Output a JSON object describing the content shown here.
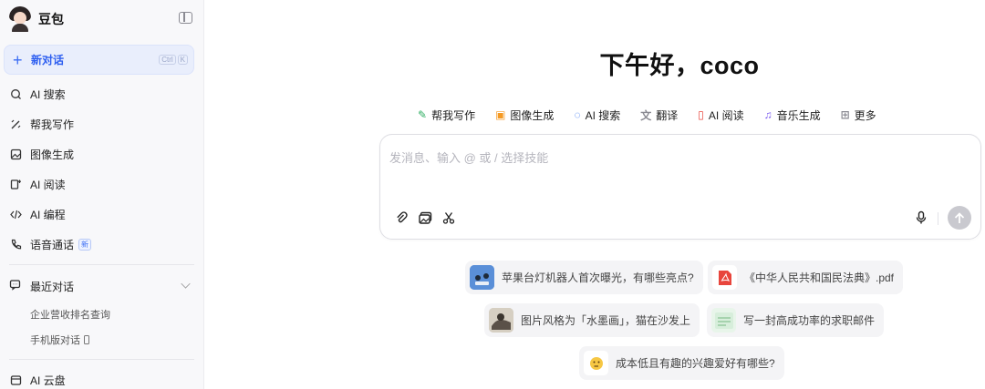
{
  "app": {
    "name": "豆包"
  },
  "sidebar": {
    "new_chat": {
      "label": "新对话",
      "shortcut": [
        "Ctrl",
        "K"
      ]
    },
    "items": [
      {
        "label": "AI 搜索",
        "icon": "search-icon"
      },
      {
        "label": "帮我写作",
        "icon": "pen-icon"
      },
      {
        "label": "图像生成",
        "icon": "image-icon"
      },
      {
        "label": "AI 阅读",
        "icon": "reader-icon"
      },
      {
        "label": "AI 编程",
        "icon": "code-icon"
      },
      {
        "label": "语音通话",
        "icon": "phone-icon",
        "badge": "新"
      }
    ],
    "recent": {
      "title": "最近对话",
      "items": [
        "企业营收排名查询",
        "手机版对话"
      ]
    },
    "cloud": {
      "label": "AI 云盘"
    }
  },
  "main": {
    "greeting": "下午好，coco",
    "skills": [
      {
        "label": "帮我写作",
        "icon": "pen-icon",
        "color": "#2fae62"
      },
      {
        "label": "图像生成",
        "icon": "image-icon",
        "color": "#f59a23"
      },
      {
        "label": "AI 搜索",
        "icon": "search-icon",
        "color": "#2d6cf0"
      },
      {
        "label": "翻译",
        "icon": "translate-icon",
        "color": "#8a8a92"
      },
      {
        "label": "AI 阅读",
        "icon": "reader-icon",
        "color": "#e8453c"
      },
      {
        "label": "音乐生成",
        "icon": "music-icon",
        "color": "#7b5cf0"
      },
      {
        "label": "更多",
        "icon": "grid-icon",
        "color": "#8a8a92"
      }
    ],
    "composer": {
      "placeholder": "发消息、输入 @ 或 / 选择技能"
    },
    "suggestions": [
      {
        "text": "苹果台灯机器人首次曝光，有哪些亮点?"
      },
      {
        "text": "《中华人民共和国民法典》.pdf"
      },
      {
        "text": "图片风格为「水墨画」，猫在沙发上"
      },
      {
        "text": "写一封高成功率的求职邮件"
      },
      {
        "text": "成本低且有趣的兴趣爱好有哪些?"
      }
    ]
  },
  "colors": {
    "accent": "#2d5ef0",
    "sidebar_bg": "#f8f8fa",
    "chip_bg": "#f4f4f6"
  }
}
